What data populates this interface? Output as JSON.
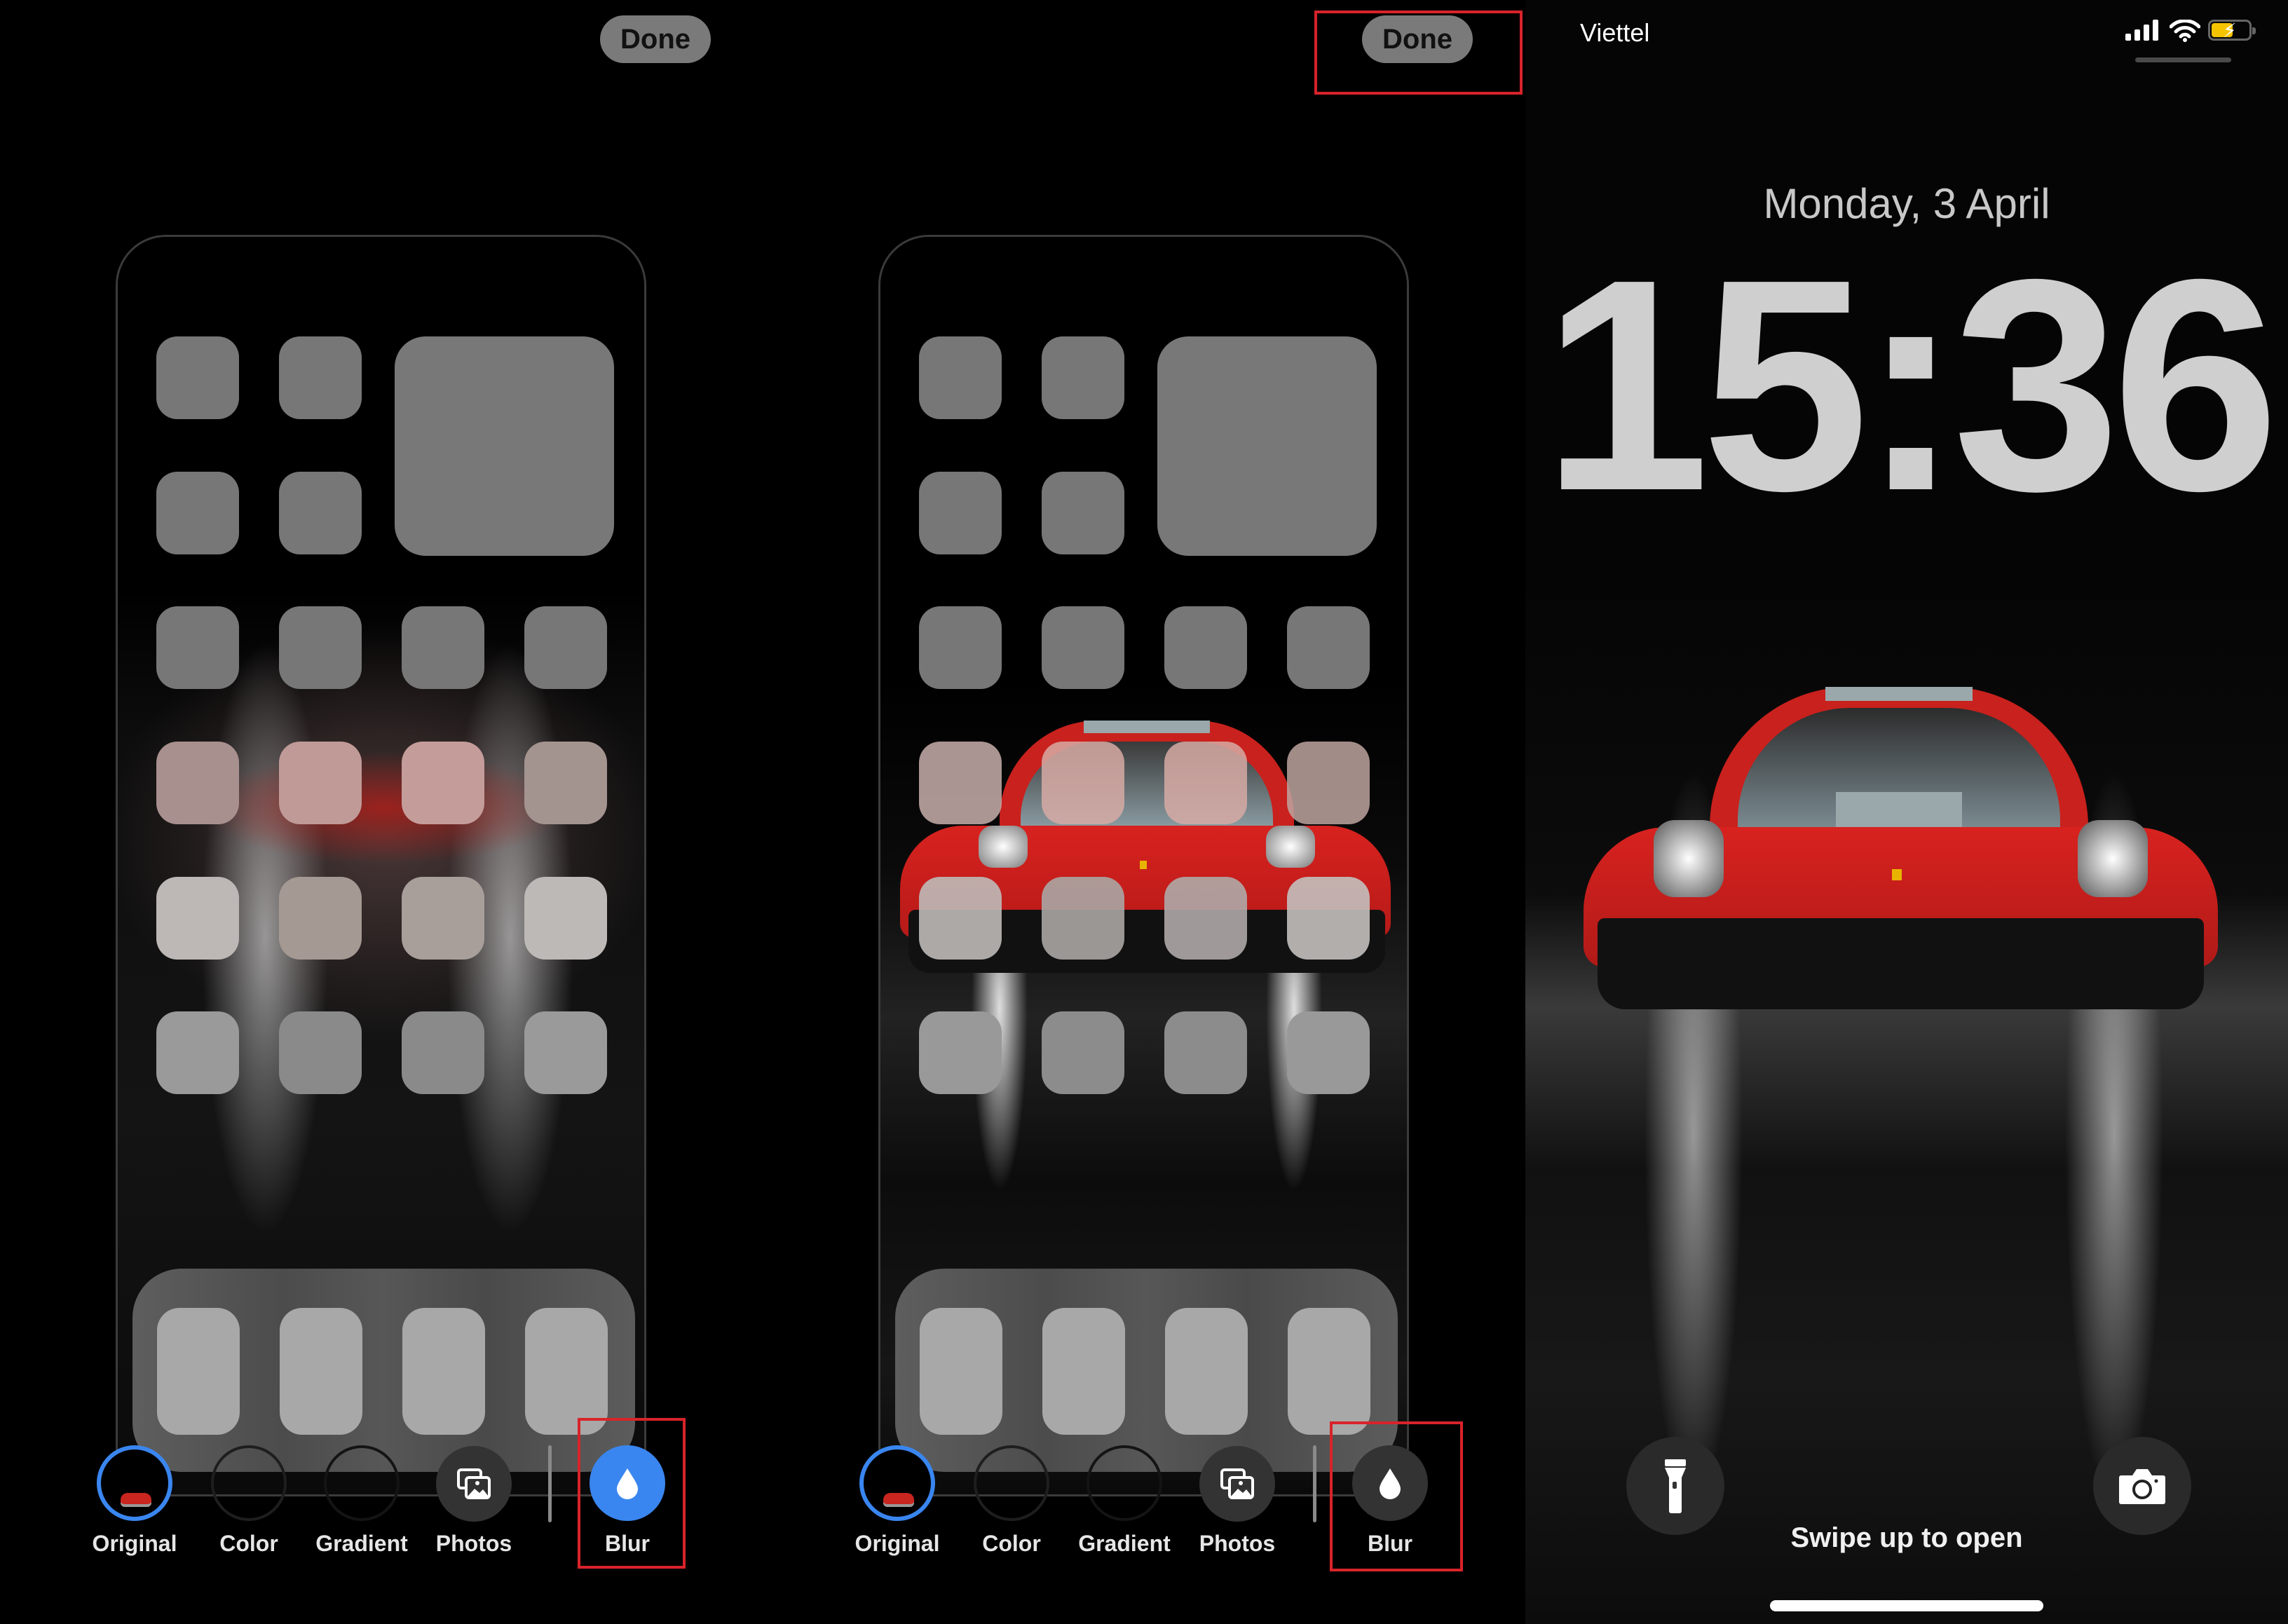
{
  "panels": [
    {
      "done_label": "Done",
      "toolbar": {
        "items": [
          {
            "label": "Original",
            "icon": "car-thumbnail",
            "selected": true
          },
          {
            "label": "Color",
            "icon": "empty-circle"
          },
          {
            "label": "Gradient",
            "icon": "empty-circle"
          },
          {
            "label": "Photos",
            "icon": "photos-icon"
          },
          {
            "label": "Blur",
            "icon": "drop-icon",
            "active": true
          }
        ]
      },
      "highlight": "blur-button"
    },
    {
      "done_label": "Done",
      "toolbar": {
        "items": [
          {
            "label": "Original",
            "icon": "car-thumbnail",
            "selected": true
          },
          {
            "label": "Color",
            "icon": "empty-circle"
          },
          {
            "label": "Gradient",
            "icon": "empty-circle"
          },
          {
            "label": "Photos",
            "icon": "photos-icon"
          },
          {
            "label": "Blur",
            "icon": "drop-icon",
            "active": false
          }
        ]
      },
      "highlight": [
        "done-button",
        "blur-button"
      ]
    }
  ],
  "lock_screen": {
    "carrier": "Viettel",
    "date": "Monday, 3 April",
    "time": "15:36",
    "swipe_hint": "Swipe up to open",
    "battery_level_percent": 60,
    "charging": true,
    "quick_actions": [
      "flashlight-icon",
      "camera-icon"
    ]
  },
  "colors": {
    "accent_blue": "#3a86f0",
    "highlight_red": "#d8232a",
    "battery_yellow": "#f5c400",
    "car_red": "#d4201e"
  }
}
